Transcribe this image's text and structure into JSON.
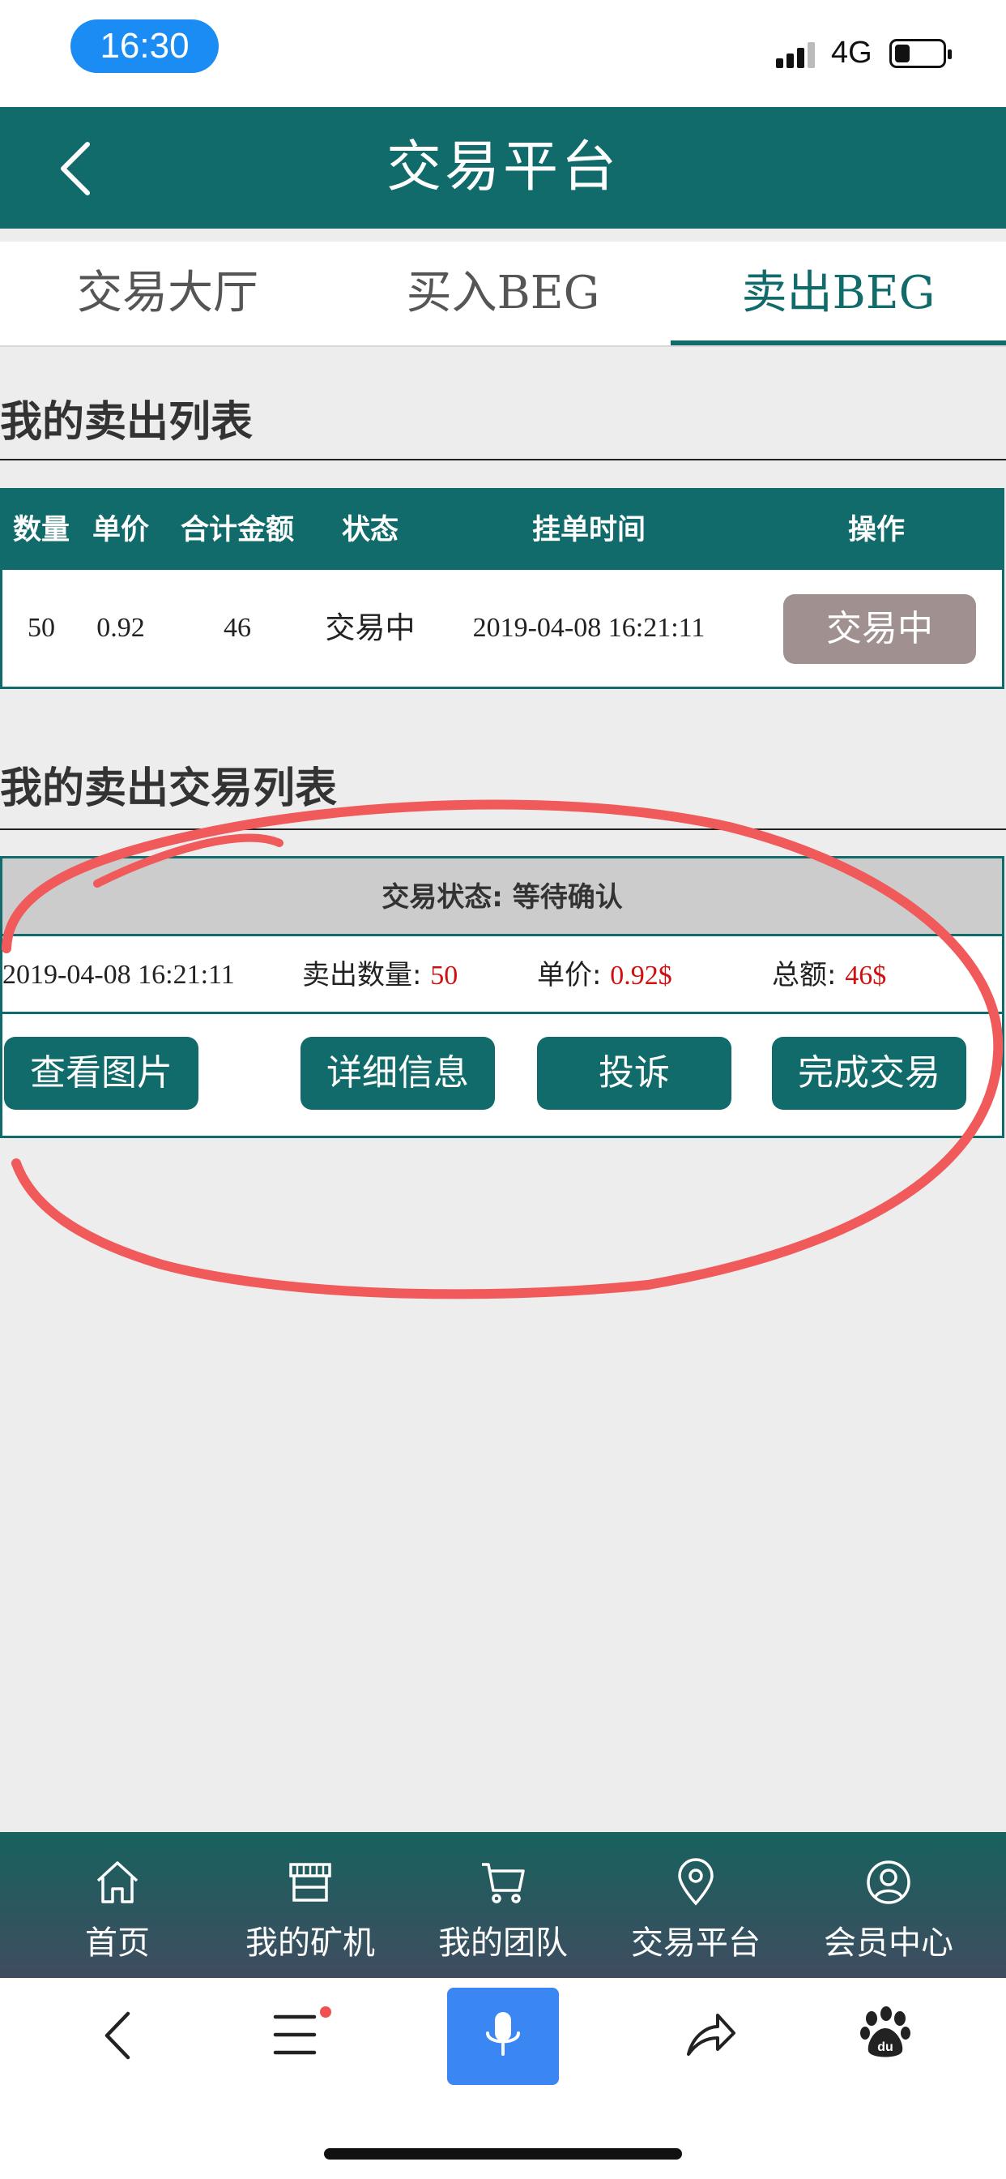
{
  "status_bar": {
    "time": "16:30",
    "network": "4G"
  },
  "header": {
    "title": "交易平台"
  },
  "tabs": [
    {
      "label": "交易大厅"
    },
    {
      "label": "买入BEG"
    },
    {
      "label": "卖出BEG"
    }
  ],
  "sell_list": {
    "title": "我的卖出列表",
    "columns": [
      "数量",
      "单价",
      "合计金额",
      "状态",
      "挂单时间",
      "操作"
    ],
    "rows": [
      {
        "quantity": "50",
        "unit_price": "0.92",
        "total": "46",
        "status": "交易中",
        "time": "2019-04-08 16:21:11",
        "action_label": "交易中"
      }
    ]
  },
  "trade_list": {
    "title": "我的卖出交易列表",
    "items": [
      {
        "status_text": "交易状态: 等待确认",
        "time": "2019-04-08 16:21:11",
        "quantity_label": "卖出数量: ",
        "quantity_value": "50",
        "price_label": "单价: ",
        "price_value": "0.92$",
        "total_label": "总额: ",
        "total_value": "46$",
        "actions": [
          "查看图片",
          "详细信息",
          "投诉",
          "完成交易"
        ]
      }
    ]
  },
  "bottom_nav": [
    {
      "label": "首页",
      "icon": "home-icon"
    },
    {
      "label": "我的矿机",
      "icon": "store-icon"
    },
    {
      "label": "我的团队",
      "icon": "cart-icon"
    },
    {
      "label": "交易平台",
      "icon": "location-pin-icon"
    },
    {
      "label": "会员中心",
      "icon": "user-icon"
    }
  ],
  "browser_toolbar": {
    "icons": [
      "back-icon",
      "menu-icon",
      "microphone-icon",
      "share-icon",
      "baidu-paw-icon"
    ]
  },
  "colors": {
    "primary": "#116b6b",
    "annotation": "#f05a5a",
    "price_red": "#d01010",
    "status_button": "#a09090",
    "mic_blue": "#3a86f3"
  }
}
